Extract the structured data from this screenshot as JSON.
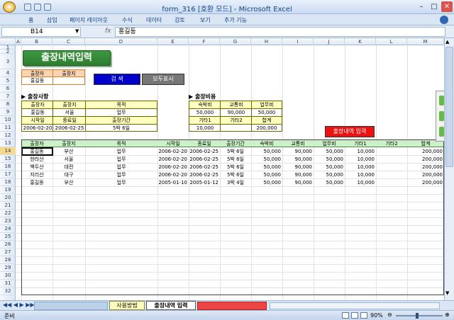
{
  "app": {
    "title": "form_316 [호환 모드] - Microsoft Excel"
  },
  "ribbon_tabs": [
    "홈",
    "삽입",
    "페이지 레이아웃",
    "수식",
    "데이터",
    "검토",
    "보기",
    "추가 기능"
  ],
  "formula_bar": {
    "cell_ref": "B14",
    "fx_label": "fx",
    "value": "홍길동"
  },
  "columns": [
    "A",
    "B",
    "C",
    "D",
    "E",
    "F",
    "G",
    "H",
    "I",
    "J",
    "K",
    "L",
    "M"
  ],
  "rows": [
    "1",
    "2",
    "3",
    "4",
    "5",
    "6",
    "7",
    "8",
    "9",
    "10",
    "11",
    "12",
    "13",
    "14",
    "15",
    "16",
    "17",
    "18",
    "19",
    "20",
    "21",
    "22",
    "23",
    "24",
    "25",
    "26",
    "27",
    "28",
    "29",
    "30",
    "31",
    "32"
  ],
  "title": "출장내역입력",
  "search_box": {
    "h1": "출장자",
    "h2": "출장지",
    "v1": "홍길동",
    "v2": ""
  },
  "buttons": {
    "search": "검 색",
    "show_all": "모두표시",
    "input": "출장내역 입력"
  },
  "section_info": {
    "label": "▶ 출장사항",
    "r1": [
      "출장자",
      "출장지",
      "목적"
    ],
    "r2": [
      "홍길동",
      "서울",
      "업무"
    ],
    "r3": [
      "시작일",
      "종료일",
      "출장기간"
    ],
    "r4": [
      "2006-02-20",
      "2006-02-25",
      "5박 6일"
    ]
  },
  "section_cost": {
    "label": "▶ 출장비용",
    "r1": [
      "숙박비",
      "교통비",
      "업무비"
    ],
    "r2": [
      "50,000",
      "90,000",
      "50,000"
    ],
    "r3": [
      "기타1",
      "기타2",
      "합계"
    ],
    "r4": [
      "10,000",
      "",
      "200,000"
    ]
  },
  "table": {
    "headers": [
      "출장자",
      "출장지",
      "목적",
      "시작일",
      "종료일",
      "출장기간",
      "숙박비",
      "교통비",
      "업무비",
      "기타1",
      "기타2",
      "합계"
    ],
    "rows": [
      [
        "홍길동",
        "부산",
        "업무",
        "2006-02-20",
        "2006-02-25",
        "5박 6일",
        "50,000",
        "90,000",
        "50,000",
        "10,000",
        "",
        "200,000"
      ],
      [
        "한라산",
        "서울",
        "업무",
        "2006-02-20",
        "2006-02-25",
        "5박 6일",
        "50,000",
        "90,000",
        "50,000",
        "10,000",
        "",
        "200,000"
      ],
      [
        "백두산",
        "대전",
        "업무",
        "2006-02-20",
        "2006-02-25",
        "5박 6일",
        "50,000",
        "90,000",
        "50,000",
        "10,000",
        "",
        "200,000"
      ],
      [
        "지리산",
        "대구",
        "업무",
        "2006-02-20",
        "2006-02-25",
        "5박 6일",
        "50,000",
        "90,000",
        "50,000",
        "10,000",
        "",
        "200,000"
      ],
      [
        "홍길동",
        "부산",
        "업무",
        "2005-01-10",
        "2005-01-12",
        "3박 4일",
        "50,000",
        "90,000",
        "50,000",
        "10,000",
        "",
        "200,000"
      ]
    ]
  },
  "sheet_tabs": [
    "사용방법",
    "출장내역 입력"
  ],
  "status": {
    "ready": "준비",
    "zoom": "90%"
  },
  "colors": {
    "title_bg": "#2f7d32",
    "header_fill": "#ffffc0",
    "green_header": "#ccf0c8",
    "search_btn": "#0000cc",
    "showall_btn": "#777777",
    "input_btn": "#ee1111"
  }
}
